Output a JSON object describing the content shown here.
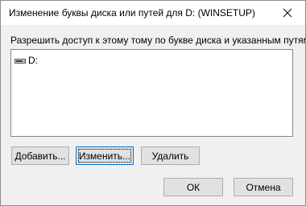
{
  "window": {
    "title": "Изменение буквы диска или путей для D: (WINSETUP)",
    "close_icon": "close-icon"
  },
  "instruction": "Разрешить доступ к этому тому по букве диска и указанным путям.",
  "paths_list": {
    "items": [
      {
        "label": "D:",
        "icon": "drive-icon"
      }
    ]
  },
  "buttons": {
    "add": "Добавить...",
    "change": "Изменить...",
    "remove": "Удалить",
    "ok": "ОК",
    "cancel": "Отмена"
  },
  "colors": {
    "window_bg": "#f0f0f0",
    "button_bg": "#e1e1e1",
    "default_button_border": "#0078d7"
  }
}
